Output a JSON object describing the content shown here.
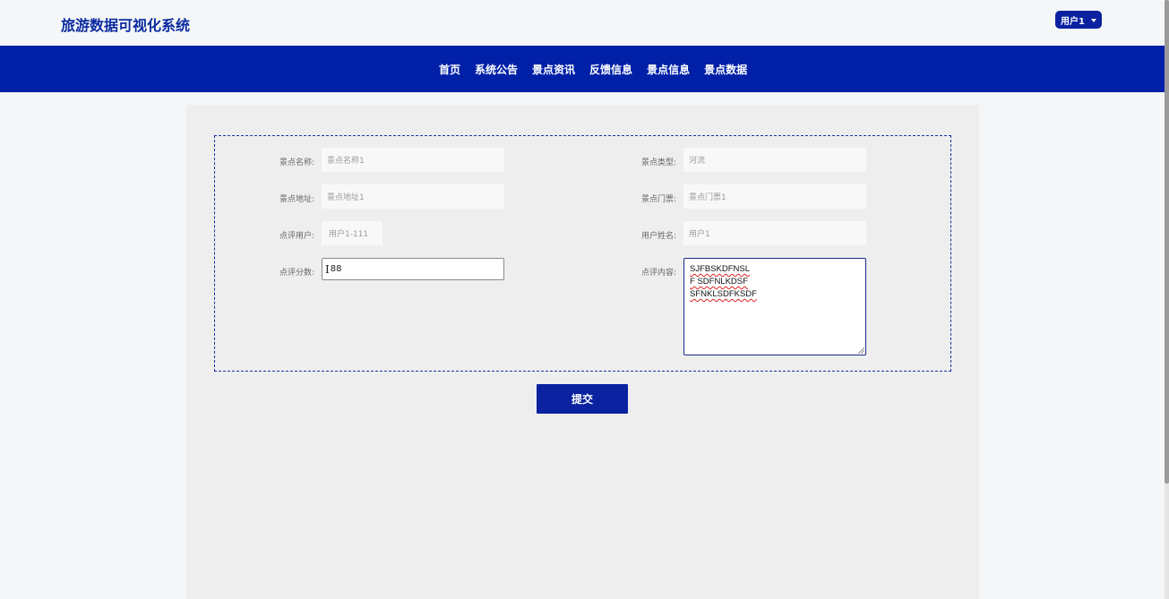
{
  "header": {
    "app_title": "旅游数据可视化系统",
    "user_menu_label": "用户1"
  },
  "nav": {
    "items": [
      {
        "label": "首页"
      },
      {
        "label": "系统公告"
      },
      {
        "label": "景点资讯"
      },
      {
        "label": "反馈信息"
      },
      {
        "label": "景点信息"
      },
      {
        "label": "景点数据"
      }
    ]
  },
  "form": {
    "spot_name": {
      "label": "景点名称:",
      "value": "景点名称1"
    },
    "spot_type": {
      "label": "景点类型:",
      "value": "河流"
    },
    "spot_address": {
      "label": "景点地址:",
      "value": "景点地址1"
    },
    "spot_ticket": {
      "label": "景点门票:",
      "value": "景点门票1"
    },
    "review_user": {
      "label": "点评用户:",
      "value": "用户1-111"
    },
    "user_name": {
      "label": "用户姓名:",
      "value": "用户1"
    },
    "review_score": {
      "label": "点评分数:",
      "value": "88"
    },
    "review_content": {
      "label": "点评内容:",
      "lines": [
        "SJFBSKDFNSL",
        "F SDFNLKDSF",
        "SFNKLSDFKSDF"
      ]
    },
    "submit_label": "提交"
  },
  "colors": {
    "brand_blue": "#0020a8",
    "title_blue": "#0a2aa0",
    "panel_bg": "#eeeeee",
    "page_bg": "#f4f6f7"
  }
}
